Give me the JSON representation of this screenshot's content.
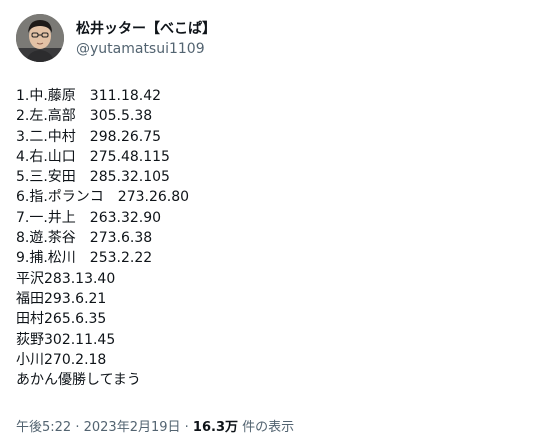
{
  "user": {
    "display_name": "松井ッター【べこぱ】",
    "handle": "@yutamatsui1109"
  },
  "tweet": {
    "lines": [
      "1.中.藤原　311.18.42",
      "2.左.高部　305.5.38",
      "3.二.中村　298.26.75",
      "4.右.山口　275.48.115",
      "5.三.安田　285.32.105",
      "6.指.ポランコ　273.26.80",
      "7.一.井上　263.32.90",
      "8.遊.茶谷　273.6.38",
      "9.捕.松川　253.2.22",
      "平沢283.13.40",
      "福田293.6.21",
      "田村265.6.35",
      "荻野302.11.45",
      "小川270.2.18",
      "あかん優勝してまう"
    ]
  },
  "meta": {
    "time": "午後5:22",
    "separator": " · ",
    "date": "2023年2月19日",
    "views_count": "16.3万",
    "views_label": " 件の表示"
  }
}
